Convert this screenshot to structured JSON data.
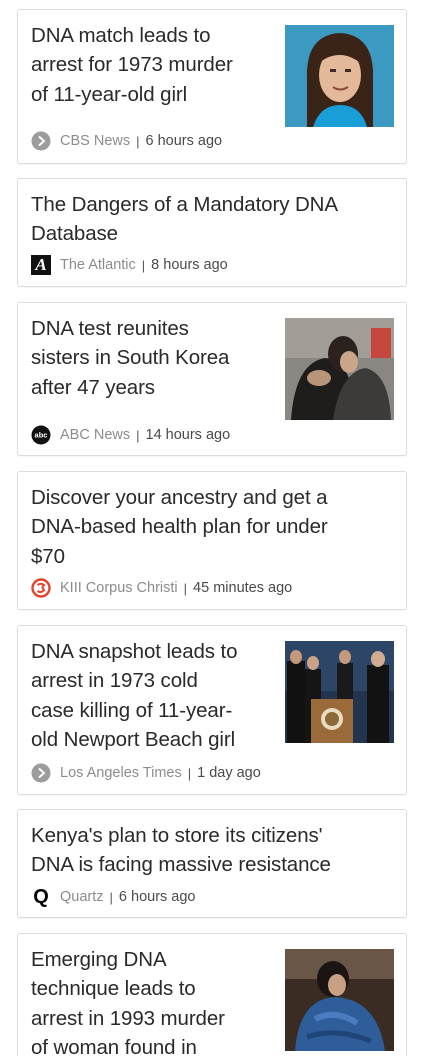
{
  "articles": [
    {
      "headline_lines": [
        "DNA match leads to",
        "arrest for 1973 murder",
        "of 11-year-old girl"
      ],
      "source": "CBS News",
      "separator": "|",
      "time": "6 hours ago",
      "logo": "play-circle-icon",
      "thumb": "girl-portrait-photo"
    },
    {
      "headline_lines": [
        "The Dangers of a Mandatory DNA",
        "Database"
      ],
      "source": "The Atlantic",
      "separator": "|",
      "time": "8 hours ago",
      "logo": "atlantic-logo-icon",
      "logo_text": "A"
    },
    {
      "headline_lines": [
        "DNA test reunites",
        "sisters in South Korea",
        "after 47 years"
      ],
      "source": "ABC News",
      "separator": "|",
      "time": "14 hours ago",
      "logo": "abc-logo-icon",
      "logo_text": "abc",
      "thumb": "hugging-women-photo"
    },
    {
      "headline_lines": [
        "Discover your ancestry and get a",
        "DNA-based health plan for under",
        "$70"
      ],
      "source": "KIII Corpus Christi",
      "separator": "|",
      "time": "45 minutes ago",
      "logo": "kiii-logo-icon"
    },
    {
      "headline_lines": [
        "DNA snapshot leads to",
        "arrest in 1973 cold",
        "case killing of 11-year-",
        "old Newport Beach girl"
      ],
      "source": "Los Angeles Times",
      "separator": "|",
      "time": "1 day ago",
      "logo": "play-circle-icon",
      "thumb": "press-conference-photo"
    },
    {
      "headline_lines": [
        "Kenya's plan to store its citizens'",
        "DNA is facing massive resistance"
      ],
      "source": "Quartz",
      "separator": "|",
      "time": "6 hours ago",
      "logo": "quartz-logo-icon",
      "logo_text": "Q"
    },
    {
      "headline_lines": [
        "Emerging DNA",
        "technique leads to",
        "arrest in 1993 murder",
        "of woman found in"
      ],
      "thumb": "woman-blue-jacket-photo"
    }
  ],
  "colors": {
    "border": "#dcdcdc",
    "source_text": "#8c8c8c",
    "time_text": "#4a4a4a",
    "kiii_red": "#e8412a"
  }
}
